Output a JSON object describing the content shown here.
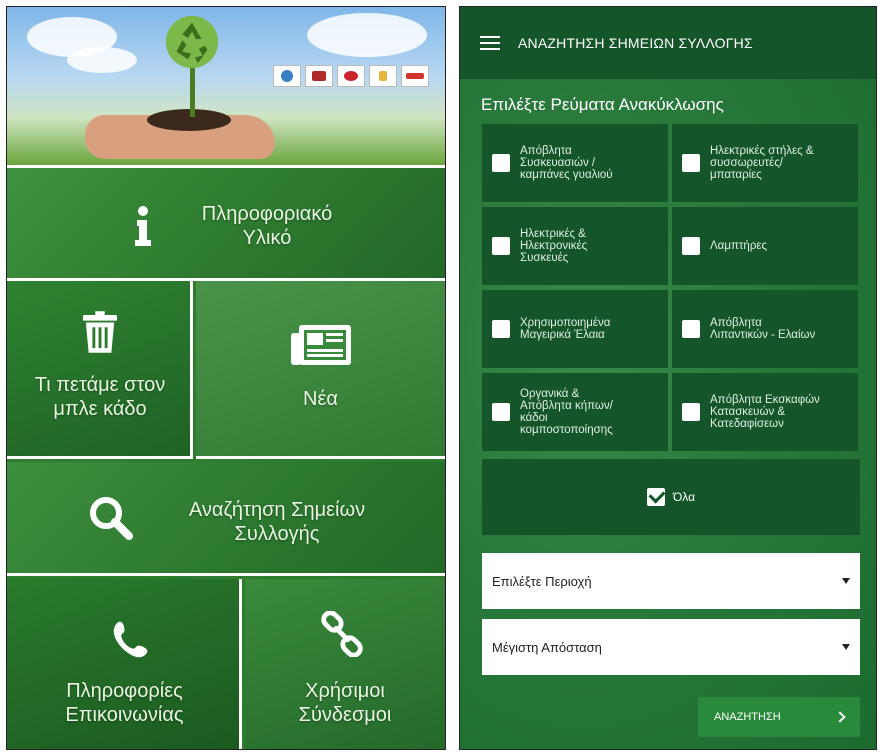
{
  "left_app": {
    "tiles": {
      "info": "Πληροφοριακό\nΥλικό",
      "bin": "Τι πετάμε στον\nμπλε κάδο",
      "news": "Νέα",
      "search": "Αναζήτηση Σημείων\nΣυλλογής",
      "contact": "Πληροφορίες\nΕπικοινωνίας",
      "links": "Χρήσιμοι\nΣύνδεσμοι"
    }
  },
  "right_app": {
    "header_title": "ΑΝΑΖΗΤΗΣΗ ΣΗΜΕΙΩΝ ΣΥΛΛΟΓΗΣ",
    "section_title": "Επιλέξτε Ρεύματα Ανακύκλωσης",
    "streams": [
      "Απόβλητα\nΣυσκευασιών /\nκαμπάνες γυαλιού",
      "Ηλεκτρικές στήλες &\nσυσσωρευτές/\nμπαταρίες",
      "Ηλεκτρικές &\nΗλεκτρονικές\nΣυσκευές",
      "Λαμπτήρες",
      "Χρησιμοποιημένα\nΜαγειρικά Έλαια",
      "Απόβλητα\nΛιπαντικών - Ελαίων",
      "Οργανικά &\nΑπόβλητα κήπων/\nκάδοι\nκομποστοποίησης",
      "Απόβλητα Εκσκαφών\nΚατασκευών &\nΚατεδαφίσεων"
    ],
    "all_label": "Όλα",
    "all_checked": true,
    "region_select": "Επιλέξτε Περιοχή",
    "distance_select": "Μέγιστη Απόσταση",
    "search_button": "ΑΝΑΖΗΤΗΣΗ"
  }
}
